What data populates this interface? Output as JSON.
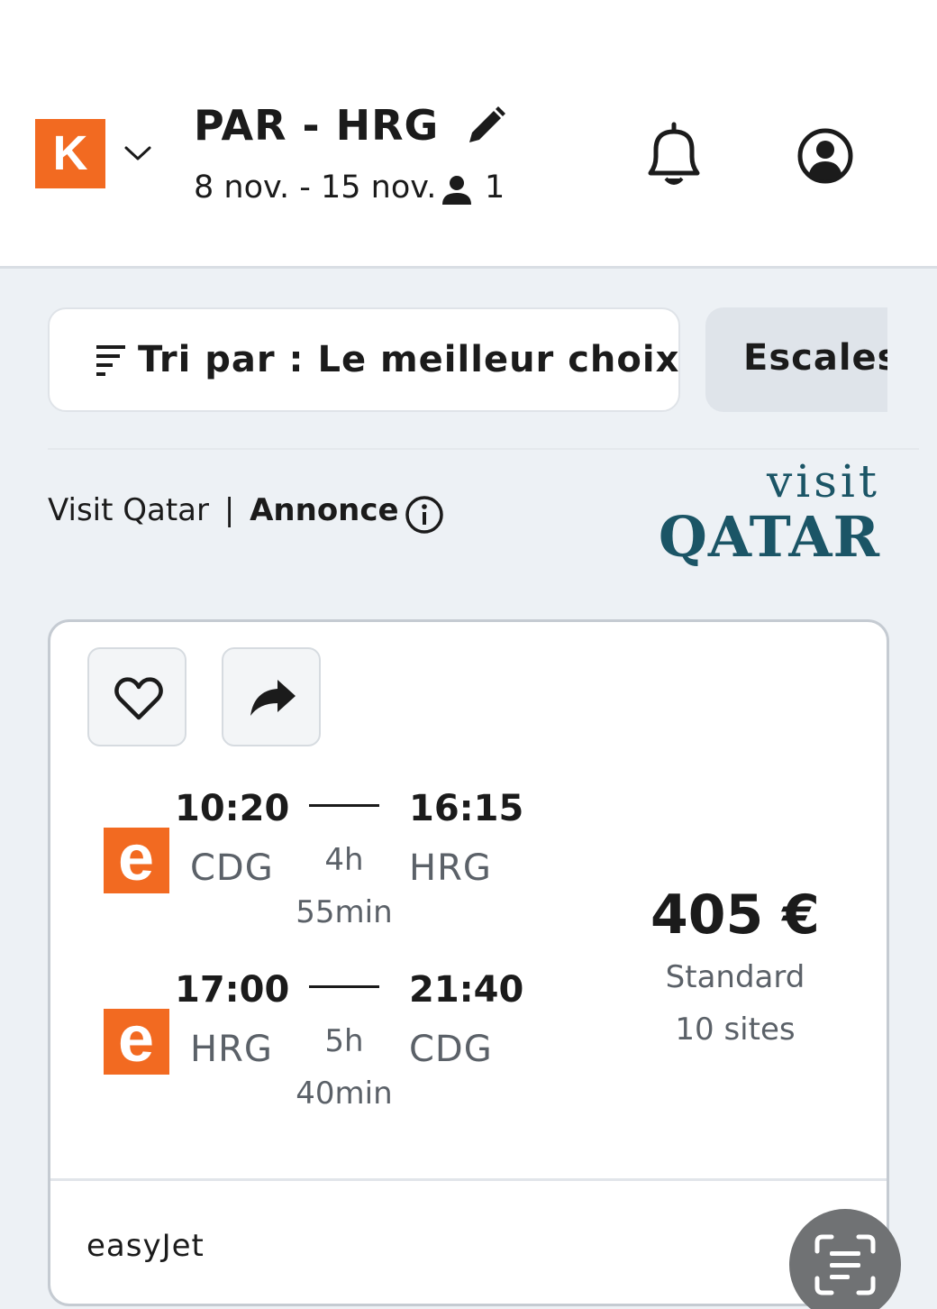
{
  "header": {
    "logo_letter": "K",
    "route": "PAR - HRG",
    "dates": "8 nov. - 15 nov.",
    "passengers": "1",
    "icons": [
      "chevron-down-icon",
      "pencil-icon",
      "person-icon",
      "bell-icon",
      "account-icon"
    ]
  },
  "filters": {
    "sort_label": "Tri par : Le meilleur choix",
    "stops_label": "Escales"
  },
  "ad": {
    "sponsor": "Visit Qatar",
    "separator": "|",
    "label": "Annonce",
    "logo_top": "visit",
    "logo_bottom": "QATAR"
  },
  "result": {
    "legs": [
      {
        "departure_time": "10:20",
        "arrival_time": "16:15",
        "origin": "CDG",
        "destination": "HRG",
        "duration_hours": "4h",
        "duration_minutes": "55min"
      },
      {
        "departure_time": "17:00",
        "arrival_time": "21:40",
        "origin": "HRG",
        "destination": "CDG",
        "duration_hours": "5h",
        "duration_minutes": "40min"
      }
    ],
    "price": "405 €",
    "fare": "Standard",
    "sites": "10 sites",
    "airline": "easyJet"
  },
  "colors": {
    "brand_orange": "#f26a21",
    "qatar_teal": "#1b5566",
    "qatar_maroon": "#8a1538",
    "background": "#edf1f5"
  }
}
